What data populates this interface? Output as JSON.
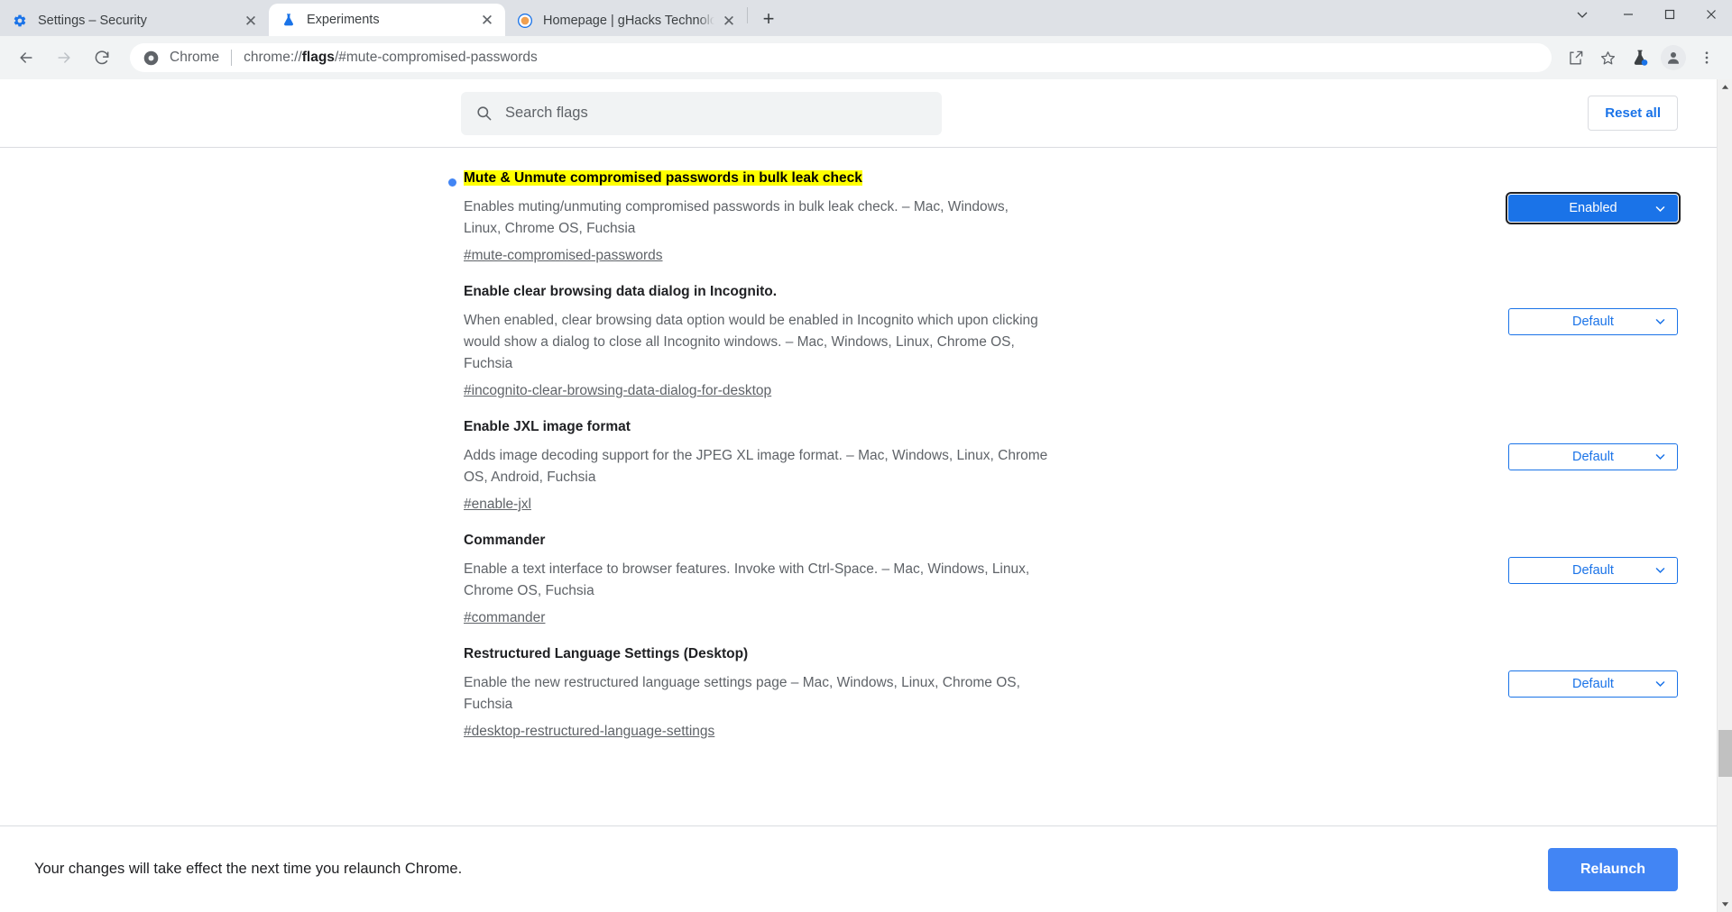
{
  "window": {
    "tabs": [
      {
        "title": "Settings – Security",
        "favicon": "gear-icon",
        "active": false
      },
      {
        "title": "Experiments",
        "favicon": "flask-icon",
        "active": true
      },
      {
        "title": "Homepage | gHacks Technology",
        "favicon": "ghacks-icon",
        "active": false
      }
    ],
    "new_tab_label": "+",
    "close_label": "✕",
    "controls": {
      "chevron": "chevron-down-icon",
      "minimize": "minimize-icon",
      "maximize": "maximize-icon",
      "close": "close-icon"
    }
  },
  "toolbar": {
    "back_icon": "back-arrow-icon",
    "forward_icon": "forward-arrow-icon",
    "reload_icon": "reload-icon",
    "omnibox": {
      "security_icon": "chrome-logo-icon",
      "scheme_label": "Chrome",
      "url_prefix": "chrome://",
      "url_emphasis": "flags",
      "url_suffix": "/#mute-compromised-passwords"
    },
    "actions": [
      {
        "name": "share-icon"
      },
      {
        "name": "bookmark-star-icon"
      },
      {
        "name": "experiments-flask-icon"
      },
      {
        "name": "profile-avatar-icon"
      },
      {
        "name": "more-menu-icon"
      }
    ]
  },
  "flags_page": {
    "search": {
      "placeholder": "Search flags",
      "value": "",
      "icon": "search-icon"
    },
    "reset_all_label": "Reset all",
    "flags": [
      {
        "title": "Mute & Unmute compromised passwords in bulk leak check",
        "highlighted": true,
        "has_dot": true,
        "description": "Enables muting/unmuting compromised passwords in bulk leak check. – Mac, Windows, Linux, Chrome OS, Fuchsia",
        "anchor": "#mute-compromised-passwords",
        "state": "Enabled",
        "state_style": "enabled"
      },
      {
        "title": "Enable clear browsing data dialog in Incognito.",
        "highlighted": false,
        "has_dot": false,
        "description": "When enabled, clear browsing data option would be enabled in Incognito which upon clicking would show a dialog to close all Incognito windows. – Mac, Windows, Linux, Chrome OS, Fuchsia",
        "anchor": "#incognito-clear-browsing-data-dialog-for-desktop",
        "state": "Default",
        "state_style": "default"
      },
      {
        "title": "Enable JXL image format",
        "highlighted": false,
        "has_dot": false,
        "description": "Adds image decoding support for the JPEG XL image format. – Mac, Windows, Linux, Chrome OS, Android, Fuchsia",
        "anchor": "#enable-jxl",
        "state": "Default",
        "state_style": "default"
      },
      {
        "title": "Commander",
        "highlighted": false,
        "has_dot": false,
        "description": "Enable a text interface to browser features. Invoke with Ctrl-Space. – Mac, Windows, Linux, Chrome OS, Fuchsia",
        "anchor": "#commander",
        "state": "Default",
        "state_style": "default"
      },
      {
        "title": "Restructured Language Settings (Desktop)",
        "highlighted": false,
        "has_dot": false,
        "description": "Enable the new restructured language settings page – Mac, Windows, Linux, Chrome OS, Fuchsia",
        "anchor": "#desktop-restructured-language-settings",
        "state": "Default",
        "state_style": "default"
      }
    ],
    "relaunch": {
      "message": "Your changes will take effect the next time you relaunch Chrome.",
      "button_label": "Relaunch"
    }
  },
  "colors": {
    "accent_blue": "#1a73e8",
    "relaunch_blue": "#4285f4",
    "highlight_yellow": "#ffff00",
    "tabstrip_gray": "#dee1e6",
    "toolbar_gray": "#f1f3f4"
  }
}
